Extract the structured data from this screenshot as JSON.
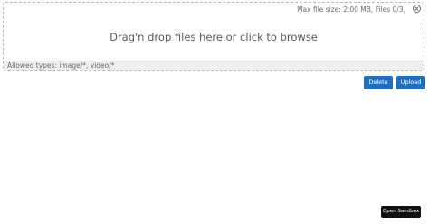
{
  "dropzone": {
    "meta_text": "Max file size: 2.00 MB, Files 0/3,",
    "main_text": "Drag'n drop files here or click to browse",
    "footer_text": "Allowed types: image/*, video/*",
    "close_icon": "close-circle-icon"
  },
  "actions": {
    "delete_label": "Delete",
    "upload_label": "Upload"
  },
  "sandbox": {
    "label": "Open Sandbox"
  },
  "colors": {
    "accent": "#1d6fc5",
    "sandbox_bg": "#111111"
  }
}
